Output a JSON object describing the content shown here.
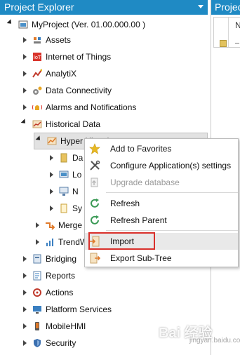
{
  "project_explorer": {
    "title": "Project Explorer"
  },
  "right_panel": {
    "title": "Project",
    "column_head": "N"
  },
  "tree": {
    "root": "MyProject (Ver. 01.00.000.00 )",
    "items": [
      {
        "label": "Assets",
        "icon": "assets-icon"
      },
      {
        "label": "Internet of Things",
        "icon": "iot-icon"
      },
      {
        "label": "AnalytiX",
        "icon": "analytix-icon"
      },
      {
        "label": "Data Connectivity",
        "icon": "data-connectivity-icon"
      },
      {
        "label": "Alarms and Notifications",
        "icon": "alarm-icon"
      },
      {
        "label": "Historical Data",
        "icon": "historical-data-icon"
      },
      {
        "label": "Hyper Historian",
        "icon": "hyper-historian-icon"
      },
      {
        "label": "Da",
        "icon": "data-storage-icon"
      },
      {
        "label": "Lo",
        "icon": "logging-icon"
      },
      {
        "label": "N",
        "icon": "network-icon"
      },
      {
        "label": "Sy",
        "icon": "system-icon"
      },
      {
        "label": "Merge",
        "icon": "merge-icon"
      },
      {
        "label": "TrendW",
        "icon": "trendworx-icon"
      },
      {
        "label": "Bridging",
        "icon": "bridging-icon"
      },
      {
        "label": "Reports",
        "icon": "reports-icon"
      },
      {
        "label": "Actions",
        "icon": "actions-icon"
      },
      {
        "label": "Platform Services",
        "icon": "platform-services-icon"
      },
      {
        "label": "MobileHMI",
        "icon": "mobilehmi-icon"
      },
      {
        "label": "Security",
        "icon": "security-icon"
      }
    ]
  },
  "context_menu": {
    "items": [
      {
        "label": "Add to Favorites",
        "icon": "star-icon",
        "enabled": true
      },
      {
        "label": "Configure Application(s) settings",
        "icon": "tools-icon",
        "enabled": true
      },
      {
        "label": "Upgrade database",
        "icon": "upgrade-icon",
        "enabled": false
      },
      {
        "label": "Refresh",
        "icon": "refresh-icon",
        "enabled": true
      },
      {
        "label": "Refresh Parent",
        "icon": "refresh-parent-icon",
        "enabled": true
      },
      {
        "label": "Import",
        "icon": "import-icon",
        "enabled": true
      },
      {
        "label": "Export Sub-Tree",
        "icon": "export-icon",
        "enabled": true
      }
    ]
  },
  "watermark": {
    "text": "Bai 经验",
    "sub": "jingyan.baidu.com"
  },
  "colors": {
    "header_blue": "#1f8ac4",
    "highlight_red": "#d9302b"
  }
}
